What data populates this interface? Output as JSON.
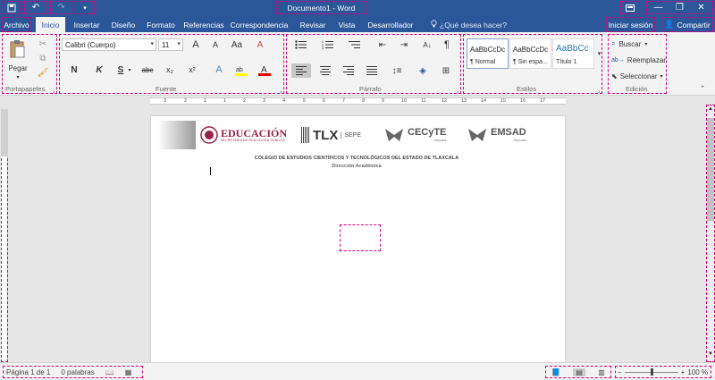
{
  "titlebar": {
    "doc_title": "Documento1 - Word",
    "save_icon": "save-icon",
    "undo_icon": "undo-icon",
    "redo_icon": "redo-icon",
    "customize_icon": "customize-qat-icon",
    "ribbon_display_icon": "ribbon-display-options-icon",
    "minimize_icon": "minimize-icon",
    "restore_icon": "restore-icon",
    "close_icon": "close-icon"
  },
  "tabs": {
    "items": [
      "Archivo",
      "Inicio",
      "Insertar",
      "Diseño",
      "Formato",
      "Referencias",
      "Correspondencia",
      "Revisar",
      "Vista",
      "Desarrollador"
    ],
    "active": "Inicio",
    "tell_me": "¿Qué desea hacer?",
    "sign_in": "Iniciar sesión",
    "share": "Compartir"
  },
  "ribbon": {
    "clipboard": {
      "paste": "Pegar",
      "label": "Portapapeles"
    },
    "font": {
      "family": "Calibri (Cuerpo)",
      "size": "11",
      "bold": "N",
      "italic": "K",
      "underline": "S",
      "strike": "abc",
      "subscript": "x₂",
      "superscript": "x²",
      "grow": "A",
      "shrink": "A",
      "case": "Aa",
      "clear": "A",
      "label": "Fuente"
    },
    "paragraph": {
      "label": "Párrafo",
      "pilcrow": "¶"
    },
    "styles": {
      "items": [
        {
          "sample": "AaBbCcDc",
          "name": "¶ Normal"
        },
        {
          "sample": "AaBbCcDc",
          "name": "¶ Sin espa..."
        },
        {
          "sample": "AaBbCc",
          "name": "Título 1"
        }
      ],
      "label": "Estilos"
    },
    "editing": {
      "find": "Buscar",
      "replace": "Reemplazar",
      "select": "Seleccionar",
      "label": "Edición"
    }
  },
  "ruler": {
    "labels": [
      "3",
      "2",
      "1",
      "1",
      "2",
      "3",
      "4",
      "5",
      "6",
      "7",
      "8",
      "9",
      "10",
      "11",
      "12",
      "13",
      "14",
      "15",
      "16",
      "17"
    ]
  },
  "document": {
    "logos": {
      "educacion": "EDUCACIÓN",
      "educacion_sub": "SECRETARÍA DE EDUCACIÓN PÚBLICA",
      "tlx": "TLX",
      "sepe": "SEPE",
      "cecyte": "CECyTE",
      "cecyte_sub": "Tlaxcala",
      "emsad": "EMSAD",
      "emsad_sub": "Tlaxcala"
    },
    "heading": "COLEGIO DE ESTUDIOS CIENTÍFICOS Y TECNOLÓGICOS DEL ESTADO DE TLAXCALA",
    "subheading": "Dirección Académica"
  },
  "statusbar": {
    "page": "Página 1 de 1",
    "words": "0 palabras",
    "zoom": "100 %",
    "zoom_level": 0.5
  },
  "colors": {
    "word_blue": "#2b579a",
    "annotation_pink": "#d6007b",
    "ribbon_bg": "#f3f3f3"
  }
}
